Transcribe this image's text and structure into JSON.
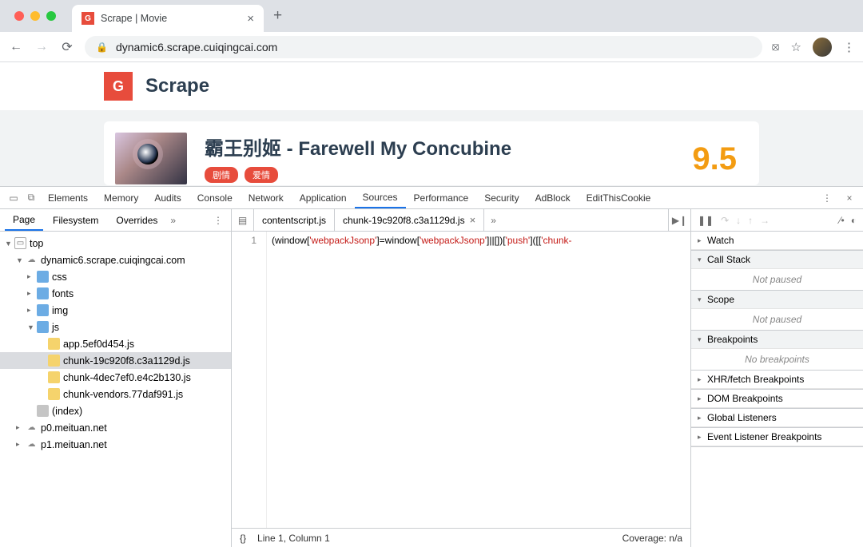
{
  "browser": {
    "tab_title": "Scrape | Movie",
    "url": "dynamic6.scrape.cuiqingcai.com"
  },
  "page": {
    "brand": "Scrape",
    "movie_title": "霸王别姬 - Farewell My Concubine",
    "pills": [
      "剧情",
      "爱情"
    ],
    "rating": "9.5"
  },
  "devtools": {
    "tabs": [
      "Elements",
      "Memory",
      "Audits",
      "Console",
      "Network",
      "Application",
      "Sources",
      "Performance",
      "Security",
      "AdBlock",
      "EditThisCookie"
    ],
    "active_tab": "Sources",
    "nav_tabs": [
      "Page",
      "Filesystem",
      "Overrides"
    ],
    "tree": {
      "root": "top",
      "domain": "dynamic6.scrape.cuiqingcai.com",
      "folders": [
        "css",
        "fonts",
        "img",
        "js"
      ],
      "js_files": [
        "app.5ef0d454.js",
        "chunk-19c920f8.c3a1129d.js",
        "chunk-4dec7ef0.e4c2b130.js",
        "chunk-vendors.77daf991.js"
      ],
      "index": "(index)",
      "extra_domains": [
        "p0.meituan.net",
        "p1.meituan.net"
      ]
    },
    "editor": {
      "tabs": [
        "contentscript.js",
        "chunk-19c920f8.c3a1129d.js"
      ],
      "active": 1,
      "line_no": "1",
      "code_prefix1": "(window[",
      "code_str1": "'webpackJsonp'",
      "code_mid": "]=window[",
      "code_str2": "'webpackJsonp'",
      "code_mid2": "]||[])[",
      "code_str3": "'push'",
      "code_mid3": "]([[",
      "code_str4": "'chunk-",
      "status_left": "Line 1, Column 1",
      "status_right": "Coverage: n/a",
      "pretty": "{}"
    },
    "debugger": {
      "sections": {
        "watch": "Watch",
        "callstack": "Call Stack",
        "callstack_body": "Not paused",
        "scope": "Scope",
        "scope_body": "Not paused",
        "breakpoints": "Breakpoints",
        "breakpoints_body": "No breakpoints",
        "xhr": "XHR/fetch Breakpoints",
        "dom": "DOM Breakpoints",
        "global": "Global Listeners",
        "event": "Event Listener Breakpoints"
      }
    }
  }
}
